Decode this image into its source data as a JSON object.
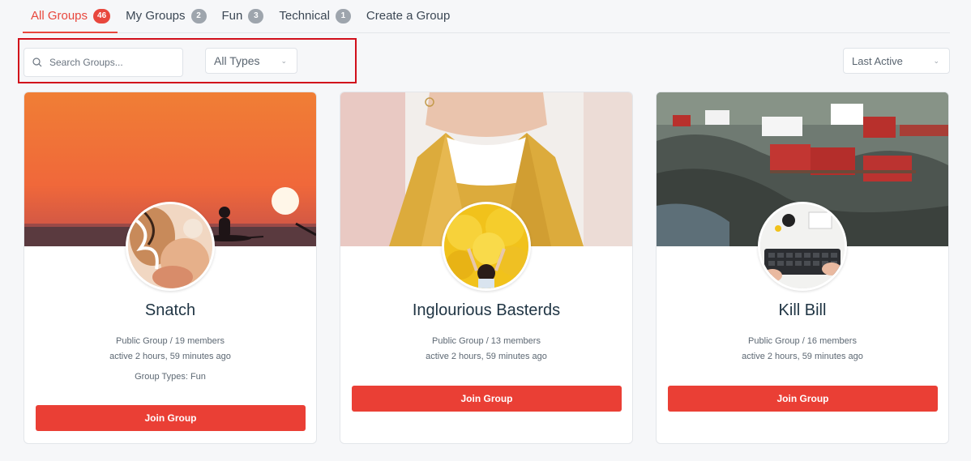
{
  "tabs": [
    {
      "label": "All Groups",
      "count": "46",
      "active": true
    },
    {
      "label": "My Groups",
      "count": "2"
    },
    {
      "label": "Fun",
      "count": "3"
    },
    {
      "label": "Technical",
      "count": "1"
    },
    {
      "label": "Create a Group"
    }
  ],
  "filters": {
    "search_placeholder": "Search Groups...",
    "type_value": "All Types",
    "sort_value": "Last Active"
  },
  "colors": {
    "accent": "#e8473d",
    "button": "#ea3f35",
    "highlight": "#d10f1b"
  },
  "groups": [
    {
      "name": "Snatch",
      "privacy_members": "Public Group / 19 members",
      "activity": "active 2 hours, 59 minutes ago",
      "types": "Group Types: Fun",
      "button": "Join Group"
    },
    {
      "name": "Inglourious Basterds",
      "privacy_members": "Public Group / 13 members",
      "activity": "active 2 hours, 59 minutes ago",
      "button": "Join Group"
    },
    {
      "name": "Kill Bill",
      "privacy_members": "Public Group / 16 members",
      "activity": "active 2 hours, 59 minutes ago",
      "button": "Join Group"
    }
  ]
}
